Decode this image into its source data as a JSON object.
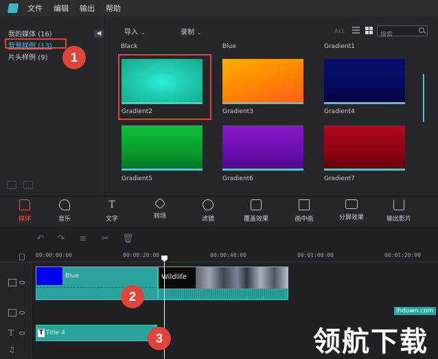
{
  "menubar": {
    "items": [
      "文件",
      "编辑",
      "输出",
      "帮助"
    ]
  },
  "library": {
    "categories": [
      {
        "label": "我的媒体 (16)"
      },
      {
        "label": "背景样例 (13)"
      },
      {
        "label": "片头样例 (9)"
      }
    ],
    "collapse_label": "◀",
    "toolbar": {
      "import_label": "导入",
      "record_label": "录制",
      "all_label": "ALL",
      "search_placeholder": "搜索"
    },
    "thumbnails": [
      {
        "label": "Black"
      },
      {
        "label": "Blue"
      },
      {
        "label": "Gradient1"
      },
      {
        "label": "Gradient2"
      },
      {
        "label": "Gradient3"
      },
      {
        "label": "Gradient4"
      },
      {
        "label": "Gradient5"
      },
      {
        "label": "Gradient6"
      },
      {
        "label": "Gradient7"
      }
    ]
  },
  "tooltabs": [
    {
      "label": "媒体",
      "icon": "folder-icon"
    },
    {
      "label": "音乐",
      "icon": "music-note-icon"
    },
    {
      "label": "文字",
      "icon": "text-icon"
    },
    {
      "label": "转场",
      "icon": "transition-icon"
    },
    {
      "label": "滤镜",
      "icon": "filter-icon"
    },
    {
      "label": "覆盖效果",
      "icon": "overlay-icon"
    },
    {
      "label": "画中画",
      "icon": "pip-icon"
    },
    {
      "label": "分屏效果",
      "icon": "split-screen-icon"
    },
    {
      "label": "输出影片",
      "icon": "export-icon"
    }
  ],
  "timeline": {
    "ruler": [
      "00:00:00:00",
      "00:00:20:00",
      "00:00:40:00",
      "00:01:00:00",
      "00:01:20:00"
    ],
    "clips": {
      "blue_label": "Blue",
      "wildlife_label": "Wildlife",
      "title_label": "Title 4"
    }
  },
  "callouts": [
    "1",
    "2",
    "3"
  ],
  "watermark": {
    "text": "领航下载",
    "sub": "lhdown.com"
  },
  "colors": {
    "accent": "#f0533b",
    "teal": "#2aa49a",
    "callout_red": "#e2433a"
  }
}
